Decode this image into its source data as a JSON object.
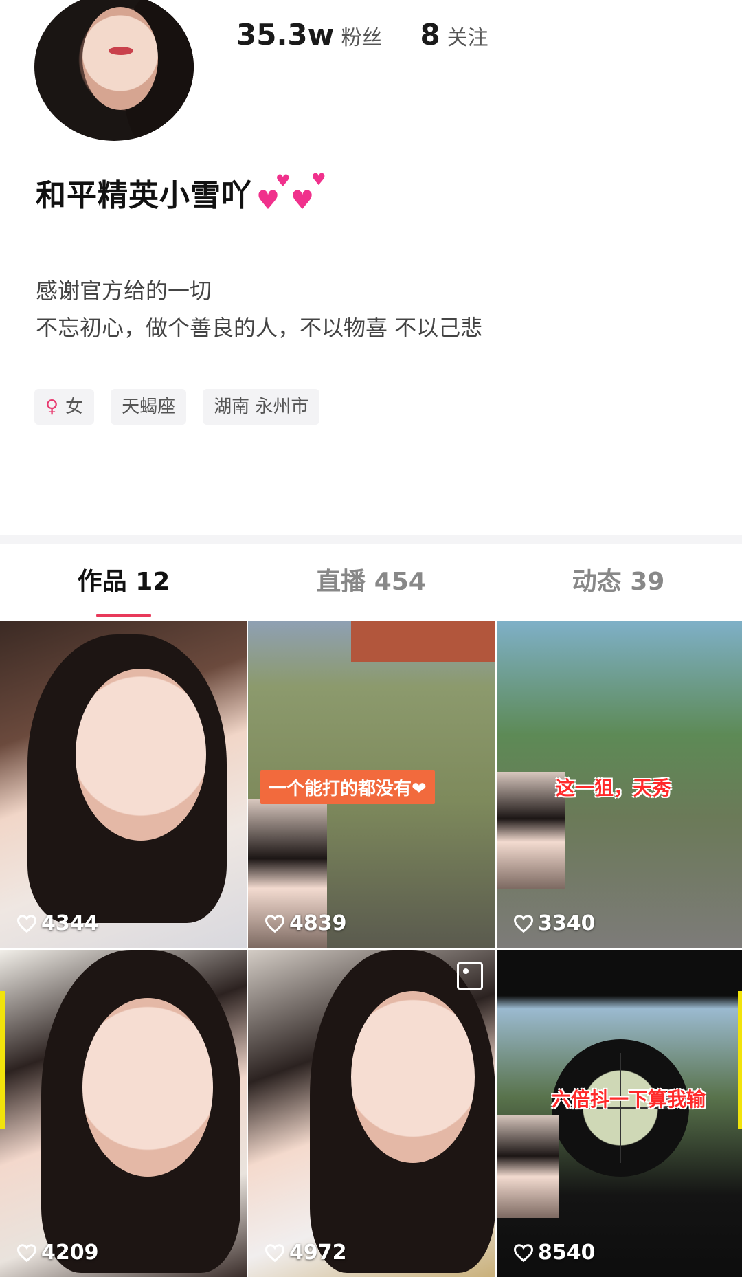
{
  "profile": {
    "followers_value": "35.3w",
    "followers_label": "粉丝",
    "following_value": "8",
    "following_label": "关注",
    "name": "和平精英小雪吖",
    "bio_line1": "感谢官方给的一切",
    "bio_line2": "不忘初心，做个善良的人，不以物喜 不以己悲",
    "tags": {
      "gender_symbol": "♀",
      "gender": "女",
      "zodiac": "天蝎座",
      "location": "湖南 永州市"
    }
  },
  "tabs": [
    {
      "label": "作品 12",
      "active": true
    },
    {
      "label": "直播 454",
      "active": false
    },
    {
      "label": "动态 39",
      "active": false
    }
  ],
  "videos": [
    {
      "likes": "4344",
      "caption": ""
    },
    {
      "likes": "4839",
      "caption": "一个能打的都没有❤"
    },
    {
      "likes": "3340",
      "caption": "这一狙，天秀"
    },
    {
      "likes": "4209",
      "caption": ""
    },
    {
      "likes": "4972",
      "caption": ""
    },
    {
      "likes": "8540",
      "caption": "六倍抖一下算我输"
    }
  ],
  "icons": {
    "heart_outline": "heart-outline-icon",
    "heart_emoji": "pink-hearts-emoji",
    "album": "album-icon"
  },
  "colors": {
    "accent": "#e8395a",
    "gender_pink": "#e8396f",
    "heart_emoji_pink": "#f0318c"
  }
}
